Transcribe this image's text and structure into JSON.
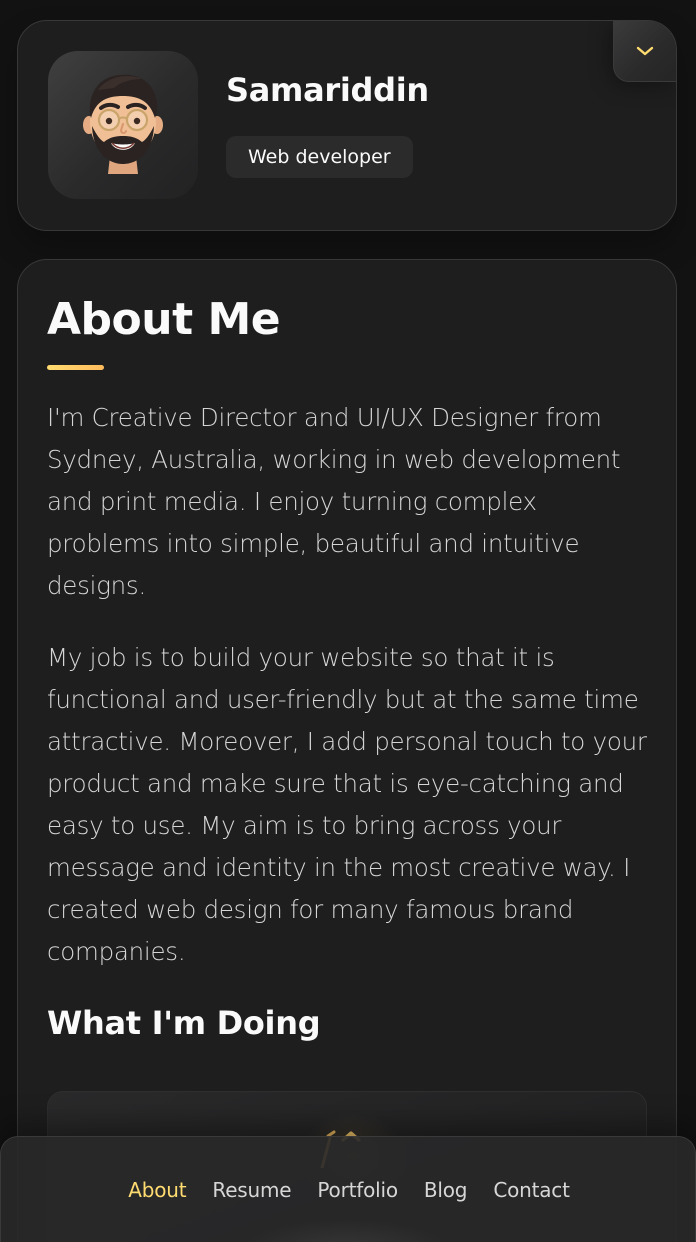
{
  "colors": {
    "accent": "#ffdb70",
    "background": "#121212",
    "card": "#1e1e1f",
    "text": "#fafafa",
    "muted_text": "#d6d6d6"
  },
  "sidebar": {
    "name": "Samariddin",
    "title": "Web developer",
    "avatar_icon": "memoji-avatar",
    "toggle_icon": "chevron-down-icon"
  },
  "about": {
    "title": "About Me",
    "paragraphs": [
      "I'm Creative Director and UI/UX Designer from Sydney, Australia, working in web development and print media. I enjoy turning complex problems into simple, beautiful and intuitive designs.",
      "My job is to build your website so that it is functional and user-friendly but at the same time attractive. Moreover, I add personal touch to your product and make sure that is eye-catching and easy to use. My aim is to bring across your message and identity in the most creative way. I created web design for many famous brand companies."
    ],
    "services_title": "What I'm Doing",
    "service_icon": "design-icon"
  },
  "navbar": {
    "active": "About",
    "items": [
      "About",
      "Resume",
      "Portfolio",
      "Blog",
      "Contact"
    ]
  }
}
